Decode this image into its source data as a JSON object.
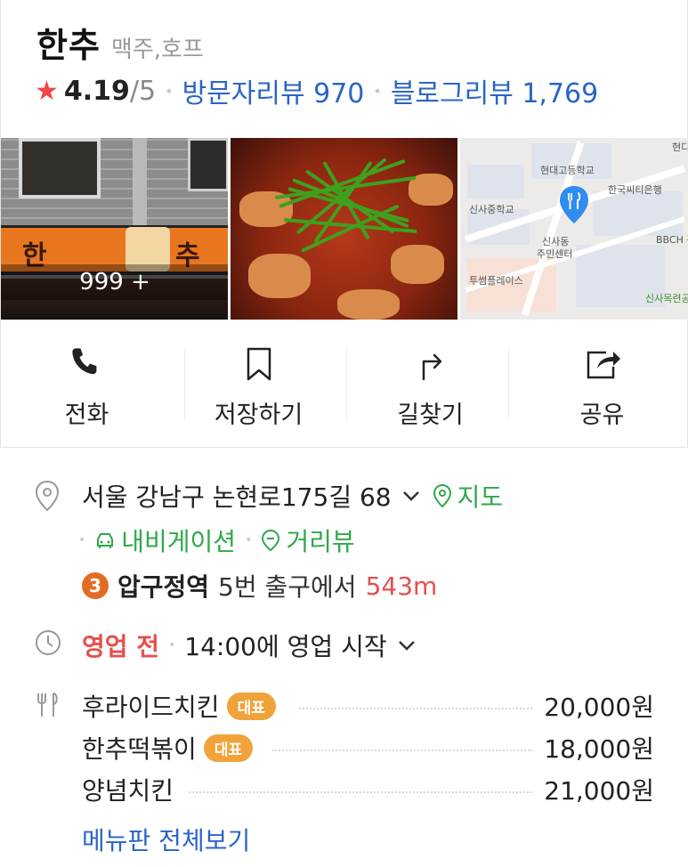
{
  "place": {
    "name": "한추",
    "category": "맥주,호프",
    "rating": "4.19",
    "rating_max": "/5",
    "visitor_reviews_label": "방문자리뷰 970",
    "blog_reviews_label": "블로그리뷰 1,769"
  },
  "photos": {
    "storefront_sign_left": "한",
    "storefront_sign_right": "추",
    "photo_count": "999 +",
    "map_labels": {
      "school1": "현대고등학교",
      "bank": "한국씨티은행",
      "school2": "신사중학교",
      "center_line1": "신사동",
      "center_line2": "주민센터",
      "bbc": "BBCH 홀",
      "place": "투썸플레이스",
      "station": "신사목련공",
      "top_right": "현디"
    }
  },
  "actions": [
    {
      "label": "전화",
      "icon": "phone-icon"
    },
    {
      "label": "저장하기",
      "icon": "bookmark-icon"
    },
    {
      "label": "길찾기",
      "icon": "directions-icon"
    },
    {
      "label": "공유",
      "icon": "share-icon"
    }
  ],
  "address": {
    "text": "서울 강남구 논현로175길 68",
    "map_link": "지도",
    "navigation_link": "내비게이션",
    "street_view_link": "거리뷰"
  },
  "subway": {
    "line": "3",
    "line_color": "#e36c23",
    "station": "압구정역",
    "exit": "5번 출구에서",
    "distance": "543m"
  },
  "hours": {
    "status": "영업 전",
    "detail": "14:00에 영업 시작"
  },
  "menu": {
    "items": [
      {
        "name": "후라이드치킨",
        "badge": "대표",
        "price": "20,000원"
      },
      {
        "name": "한추떡볶이",
        "badge": "대표",
        "price": "18,000원"
      },
      {
        "name": "양념치킨",
        "badge": "",
        "price": "21,000원"
      }
    ],
    "view_all": "메뉴판 전체보기"
  },
  "colors": {
    "link_blue": "#2a64c7",
    "green": "#2ea84a",
    "red": "#e5504d",
    "star": "#f04646",
    "badge": "#f1a33a"
  }
}
